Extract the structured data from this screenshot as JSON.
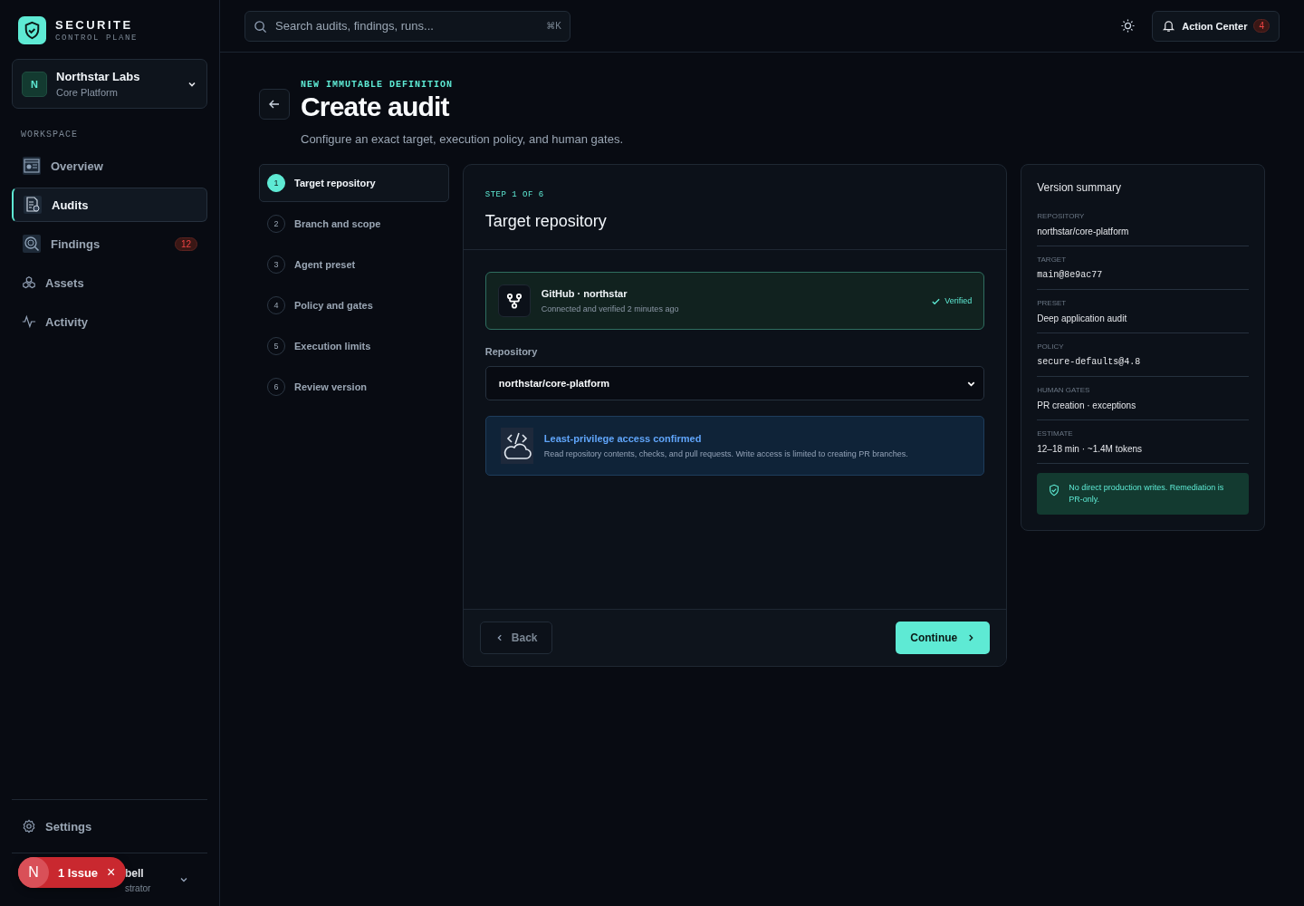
{
  "brand": {
    "name": "SECURITE",
    "tagline": "CONTROL PLANE"
  },
  "org": {
    "initial": "N",
    "name": "Northstar Labs",
    "sub": "Core Platform"
  },
  "nav_section": "WORKSPACE",
  "nav": [
    {
      "label": "Overview",
      "selected": false
    },
    {
      "label": "Audits",
      "selected": true
    },
    {
      "label": "Findings",
      "selected": false,
      "badge": "12"
    },
    {
      "label": "Assets",
      "selected": false
    },
    {
      "label": "Activity",
      "selected": false
    }
  ],
  "settings": "Settings",
  "user": {
    "name": "bell",
    "role": "strator"
  },
  "issue_toast": {
    "initial": "N",
    "label": "1 Issue",
    "close": "×"
  },
  "search": {
    "placeholder": "Search audits, findings, runs...",
    "shortcut": "⌘K"
  },
  "action_center": {
    "label": "Action Center",
    "count": "4"
  },
  "header": {
    "eyebrow": "NEW IMMUTABLE DEFINITION",
    "title": "Create audit",
    "subtitle": "Configure an exact target, execution policy, and human gates."
  },
  "steps": [
    {
      "number": "1",
      "label": "Target repository",
      "selected": true
    },
    {
      "number": "2",
      "label": "Branch and scope",
      "selected": false
    },
    {
      "number": "3",
      "label": "Agent preset",
      "selected": false
    },
    {
      "number": "4",
      "label": "Policy and gates",
      "selected": false
    },
    {
      "number": "5",
      "label": "Execution limits",
      "selected": false
    },
    {
      "number": "6",
      "label": "Review version",
      "selected": false
    }
  ],
  "panel": {
    "step_label": "STEP 1 OF 6",
    "title": "Target repository",
    "connection": {
      "title": "GitHub · northstar",
      "detail": "Connected and verified 2 minutes ago",
      "status": "Verified",
      "verified": true
    },
    "repository_label": "Repository",
    "repository_value": "northstar/core-platform",
    "access": {
      "title": "Least-privilege access confirmed",
      "detail": "Read repository contents, checks, and pull requests. Write access is limited to creating PR branches."
    },
    "back": "Back",
    "continue": "Continue"
  },
  "summary": {
    "title": "Version summary",
    "items": [
      {
        "label": "REPOSITORY",
        "value": "northstar/core-platform",
        "kind": "text"
      },
      {
        "label": "TARGET",
        "value": "main@8e9ac77",
        "kind": "code"
      },
      {
        "label": "PRESET",
        "value": "Deep application audit",
        "kind": "text"
      },
      {
        "label": "POLICY",
        "value": "secure-defaults@4.8",
        "kind": "code"
      },
      {
        "label": "HUMAN GATES",
        "value": "PR creation · exceptions",
        "kind": "text"
      },
      {
        "label": "ESTIMATE",
        "value": "12–18 min · ~1.4M tokens",
        "kind": "text"
      }
    ],
    "note": "No direct production writes. Remediation is PR-only."
  }
}
